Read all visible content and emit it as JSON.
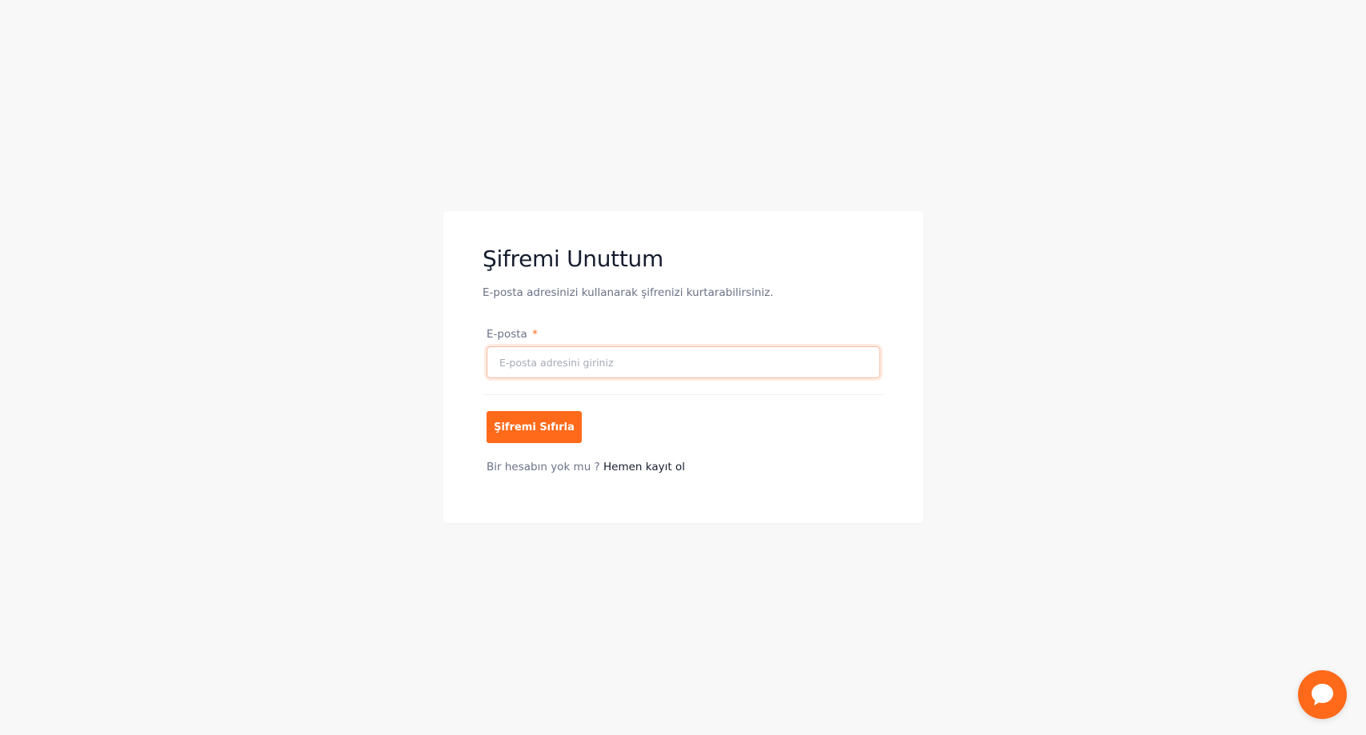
{
  "page": {
    "title": "Şifremi Unuttum",
    "subtitle": "E-posta adresinizi kullanarak şifrenizi kurtarabilirsiniz."
  },
  "form": {
    "email_label": "E-posta",
    "required_mark": "*",
    "email_value": "",
    "email_placeholder": "E-posta adresini giriniz",
    "submit_label": "Şifremi Sıfırla"
  },
  "signup": {
    "prompt": "Bir hesabın yok mu ?",
    "link_label": "Hemen kayıt ol"
  },
  "chat_widget": {
    "icon": "chat-bubble-icon"
  },
  "colors": {
    "accent": "#ff6a1a",
    "background": "#f8f8f8",
    "card": "#ffffff",
    "heading": "#161d2e",
    "muted": "#6b7287"
  }
}
